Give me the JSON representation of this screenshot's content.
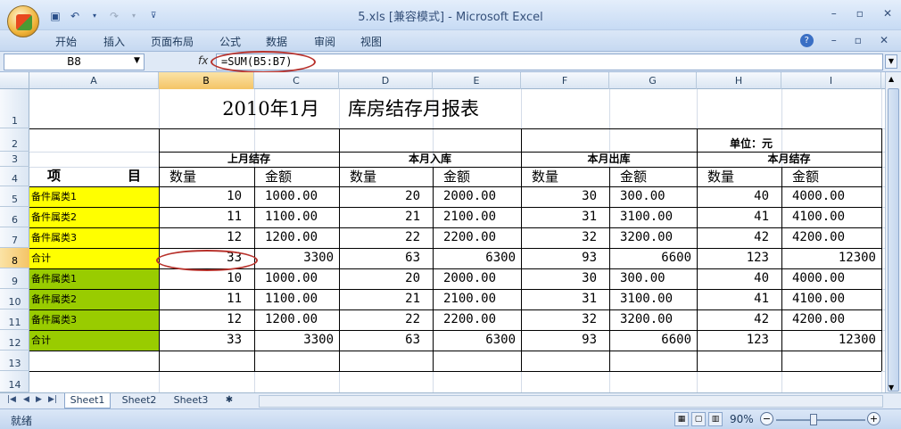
{
  "window": {
    "title": "5.xls  [兼容模式] - Microsoft Excel",
    "controls": [
      "–",
      "▫",
      "✕"
    ]
  },
  "quick_access": [
    "save-icon",
    "undo-icon",
    "redo-icon",
    "customize-icon"
  ],
  "menu": [
    "开始",
    "插入",
    "页面布局",
    "公式",
    "数据",
    "审阅",
    "视图"
  ],
  "formula_bar": {
    "name_box": "B8",
    "fx": "fx",
    "formula": "=SUM(B5:B7)"
  },
  "columns": [
    "A",
    "B",
    "C",
    "D",
    "E",
    "F",
    "G",
    "H",
    "I"
  ],
  "rows": [
    "1",
    "2",
    "3",
    "4",
    "5",
    "6",
    "7",
    "8",
    "9",
    "10",
    "11",
    "12",
    "13",
    "14"
  ],
  "selected": {
    "column": "B",
    "row": "8"
  },
  "sheet": {
    "title_date": "2010年1月",
    "title_name": "库房结存月报表",
    "unit": "单位：元",
    "item_label_1": "项",
    "item_label_2": "目",
    "groups": [
      "上月结存",
      "本月入库",
      "本月出库",
      "本月结存"
    ],
    "subheaders": [
      "数量",
      "金额",
      "数量",
      "金额",
      "数量",
      "金额",
      "数量",
      "金额"
    ],
    "data_rows": [
      {
        "label": "备件属类1",
        "cells": [
          "10",
          "1000.00",
          "20",
          "2000.00",
          "30",
          "300.00",
          "40",
          "4000.00"
        ]
      },
      {
        "label": "备件属类2",
        "cells": [
          "11",
          "1100.00",
          "21",
          "2100.00",
          "31",
          "3100.00",
          "41",
          "4100.00"
        ]
      },
      {
        "label": "备件属类3",
        "cells": [
          "12",
          "1200.00",
          "22",
          "2200.00",
          "32",
          "3200.00",
          "42",
          "4200.00"
        ]
      },
      {
        "label": "合计",
        "cells": [
          "33",
          "3300",
          "63",
          "6300",
          "93",
          "6600",
          "123",
          "12300"
        ]
      },
      {
        "label": "备件属类1",
        "cells": [
          "10",
          "1000.00",
          "20",
          "2000.00",
          "30",
          "300.00",
          "40",
          "4000.00"
        ]
      },
      {
        "label": "备件属类2",
        "cells": [
          "11",
          "1100.00",
          "21",
          "2100.00",
          "31",
          "3100.00",
          "41",
          "4100.00"
        ]
      },
      {
        "label": "备件属类3",
        "cells": [
          "12",
          "1200.00",
          "22",
          "2200.00",
          "32",
          "3200.00",
          "42",
          "4200.00"
        ]
      },
      {
        "label": "合计",
        "cells": [
          "33",
          "3300",
          "63",
          "6300",
          "93",
          "6600",
          "123",
          "12300"
        ]
      }
    ],
    "fill_colors": {
      "block1": "#ffff00",
      "block2": "#99cc00"
    }
  },
  "sheet_tabs": [
    "Sheet1",
    "Sheet2",
    "Sheet3"
  ],
  "status": {
    "ready": "就绪",
    "zoom": "90%"
  }
}
